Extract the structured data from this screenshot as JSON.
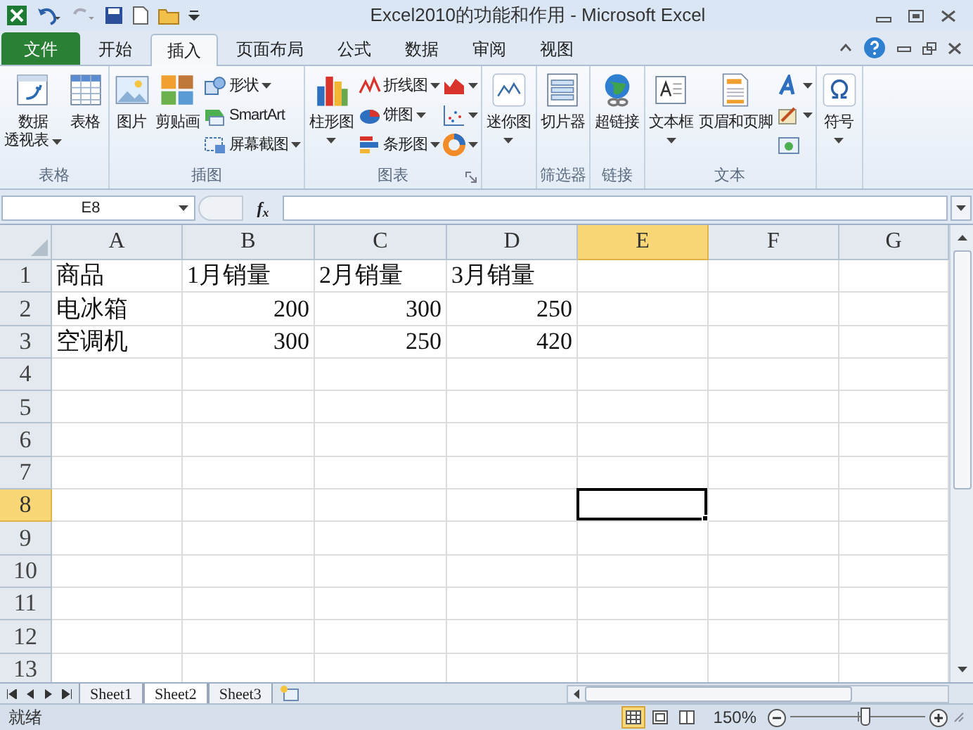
{
  "window": {
    "title": "Excel2010的功能和作用 - Microsoft Excel"
  },
  "tabs": [
    {
      "label": "文件",
      "kind": "file",
      "selected": false
    },
    {
      "label": "开始",
      "kind": "tab",
      "selected": false
    },
    {
      "label": "插入",
      "kind": "tab",
      "selected": true
    },
    {
      "label": "页面布局",
      "kind": "tab",
      "selected": false
    },
    {
      "label": "公式",
      "kind": "tab",
      "selected": false
    },
    {
      "label": "数据",
      "kind": "tab",
      "selected": false
    },
    {
      "label": "审阅",
      "kind": "tab",
      "selected": false
    },
    {
      "label": "视图",
      "kind": "tab",
      "selected": false
    }
  ],
  "ribbon_groups": [
    {
      "label": "表格",
      "items": [
        {
          "kind": "large",
          "lines": [
            "数据",
            "透视表"
          ],
          "dropdown": true
        },
        {
          "kind": "large",
          "lines": [
            "表格"
          ],
          "dropdown": false
        }
      ]
    },
    {
      "label": "插图",
      "items": [
        {
          "kind": "large",
          "lines": [
            "图片"
          ],
          "dropdown": false
        },
        {
          "kind": "large",
          "lines": [
            "剪贴画"
          ],
          "dropdown": false
        },
        {
          "kind": "small",
          "lines": [
            "形状"
          ],
          "dropdown": true
        },
        {
          "kind": "small",
          "lines": [
            "SmartArt"
          ],
          "dropdown": false
        },
        {
          "kind": "small",
          "lines": [
            "屏幕截图"
          ],
          "dropdown": true
        }
      ]
    },
    {
      "label": "图表",
      "launcher": true,
      "items": [
        {
          "kind": "large",
          "lines": [
            "柱形图"
          ],
          "dropdown": true
        },
        {
          "kind": "small",
          "lines": [
            "折线图"
          ],
          "dropdown": true
        },
        {
          "kind": "small",
          "lines": [
            "饼图"
          ],
          "dropdown": true
        },
        {
          "kind": "small",
          "lines": [
            "条形图"
          ],
          "dropdown": true
        },
        {
          "kind": "icon",
          "dropdown": true
        },
        {
          "kind": "icon",
          "dropdown": true
        },
        {
          "kind": "icon",
          "dropdown": true
        }
      ]
    },
    {
      "items": [
        {
          "kind": "large",
          "lines": [
            "迷你图"
          ],
          "dropdown": true
        }
      ]
    },
    {
      "label": "筛选器",
      "items": [
        {
          "kind": "large",
          "lines": [
            "切片器"
          ],
          "dropdown": false
        }
      ]
    },
    {
      "label": "链接",
      "items": [
        {
          "kind": "large",
          "lines": [
            "超链接"
          ],
          "dropdown": false
        }
      ]
    },
    {
      "label": "文本",
      "items": [
        {
          "kind": "large",
          "lines": [
            "文本框"
          ],
          "dropdown": true
        },
        {
          "kind": "large",
          "lines": [
            "页眉和页脚"
          ],
          "dropdown": false
        },
        {
          "kind": "icon",
          "dropdown": true
        },
        {
          "kind": "icon",
          "dropdown": true
        },
        {
          "kind": "icon",
          "dropdown": false
        }
      ]
    },
    {
      "items": [
        {
          "kind": "large",
          "lines": [
            "符号"
          ],
          "dropdown": true
        }
      ]
    }
  ],
  "formula_bar": {
    "name_box": "E8",
    "function_label": "f$_{x}$"
  },
  "grid": {
    "columns": [
      {
        "label": "A",
        "selected": false
      },
      {
        "label": "B",
        "selected": false
      },
      {
        "label": "C",
        "selected": false
      },
      {
        "label": "D",
        "selected": false
      },
      {
        "label": "E",
        "selected": true
      },
      {
        "label": "F",
        "selected": false
      },
      {
        "label": "G",
        "selected": false
      }
    ],
    "rows": [
      {
        "label": "1",
        "selected": false,
        "cells": [
          {
            "text": "商品",
            "kind": "text"
          },
          {
            "text": "1月销量",
            "kind": "text"
          },
          {
            "text": "2月销量",
            "kind": "text"
          },
          {
            "text": "3月销量",
            "kind": "text"
          }
        ]
      },
      {
        "label": "2",
        "selected": false,
        "cells": [
          {
            "text": "电冰箱",
            "kind": "text"
          },
          {
            "text": "200",
            "kind": "number"
          },
          {
            "text": "300",
            "kind": "number"
          },
          {
            "text": "250",
            "kind": "number"
          }
        ]
      },
      {
        "label": "3",
        "selected": false,
        "cells": [
          {
            "text": "空调机",
            "kind": "text"
          },
          {
            "text": "300",
            "kind": "number"
          },
          {
            "text": "250",
            "kind": "number"
          },
          {
            "text": "420",
            "kind": "number"
          }
        ]
      },
      {
        "label": "4",
        "selected": false
      },
      {
        "label": "5",
        "selected": false
      },
      {
        "label": "6",
        "selected": false
      },
      {
        "label": "7",
        "selected": false
      },
      {
        "label": "8",
        "selected": true
      },
      {
        "label": "9",
        "selected": false
      },
      {
        "label": "10",
        "selected": false
      },
      {
        "label": "11",
        "selected": false
      },
      {
        "label": "12",
        "selected": false
      },
      {
        "label": "13",
        "selected": false
      }
    ]
  },
  "sheet_tabs": [
    {
      "label": "Sheet1",
      "selected": false
    },
    {
      "label": "Sheet2",
      "selected": true
    },
    {
      "label": "Sheet3",
      "selected": false
    }
  ],
  "status_bar": {
    "status": "就绪",
    "views": [
      {
        "selected": true
      },
      {
        "selected": false
      },
      {
        "selected": false
      }
    ],
    "zoom": "150%",
    "zoom_slider": {
      "level": 0.55
    }
  }
}
